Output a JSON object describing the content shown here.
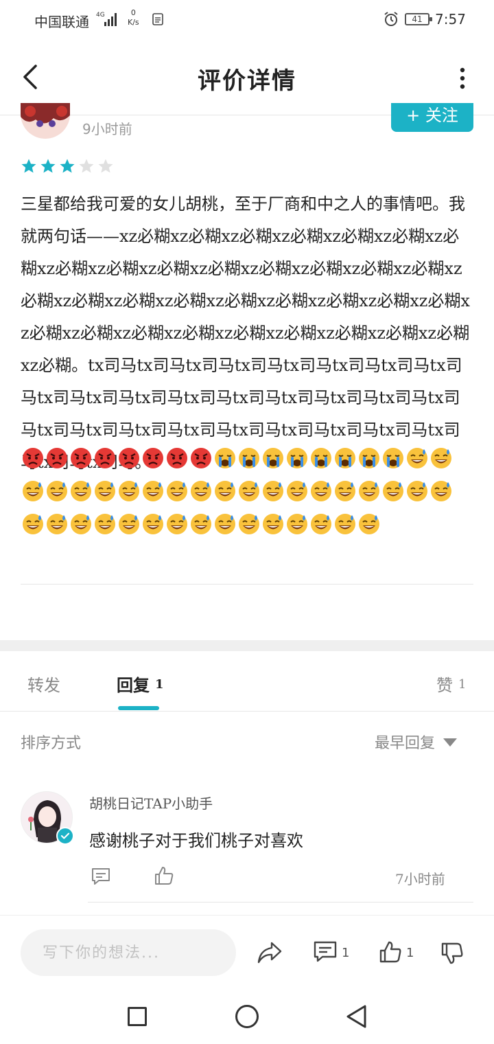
{
  "status_bar": {
    "carrier": "中国联通",
    "network": "4G",
    "speed_value": "0",
    "speed_unit": "K/s",
    "battery": "41",
    "time": "7:57"
  },
  "header": {
    "title": "评价详情"
  },
  "review": {
    "time": "9小时前",
    "follow_label": "+ 关注",
    "rating": 3,
    "rating_max": 5,
    "text": "三星都给我可爱的女儿胡桃，至于厂商和中之人的事情吧。我就两句话——xz必糊xz必糊xz必糊xz必糊xz必糊xz必糊xz必糊xz必糊xz必糊xz必糊xz必糊xz必糊xz必糊xz必糊xz必糊xz必糊xz必糊xz必糊xz必糊xz必糊xz必糊xz必糊xz必糊xz必糊xz必糊xz必糊xz必糊xz必糊xz必糊xz必糊xz必糊xz必糊xz必糊xz必糊。tx司马tx司马tx司马tx司马tx司马tx司马tx司马tx司马tx司马tx司马tx司马tx司马tx司马tx司马tx司马tx司马tx司马tx司马tx司马tx司马tx司马tx司马tx司马tx司马tx司马tx司马tx司马tx司马。",
    "emojis": {
      "angry_count": 8,
      "crying_count": 8,
      "sweat_smile_count": 35
    }
  },
  "tabs": {
    "forward_label": "转发",
    "reply_label": "回复",
    "reply_count": "1",
    "like_label": "赞",
    "like_count": "1"
  },
  "sort": {
    "label": "排序方式",
    "selected": "最早回复"
  },
  "reply": {
    "author": "胡桃日记TAP小助手",
    "text": "感谢桃子对于我们桃子对喜欢",
    "time": "7小时前"
  },
  "bottom_bar": {
    "placeholder": "写下你的想法...",
    "comment_count": "1",
    "like_count": "1"
  },
  "colors": {
    "accent": "#1cb2c6",
    "star_filled": "#1cb2c6",
    "star_empty": "#e0e0e0"
  }
}
